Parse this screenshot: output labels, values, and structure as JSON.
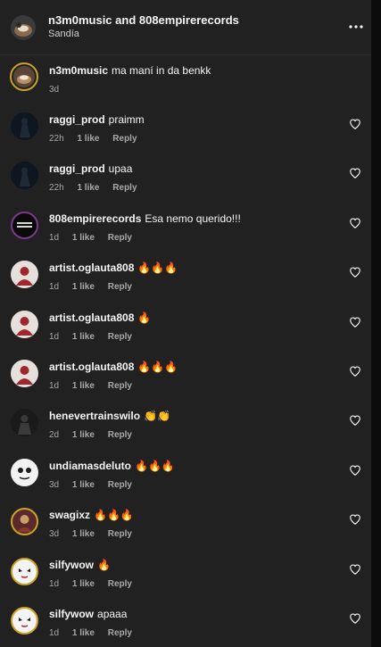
{
  "header": {
    "title": "n3m0music and 808empirerecords",
    "subtitle": "Sandía"
  },
  "caption": {
    "username": "n3m0music",
    "text": "ma maní in da benkk",
    "time": "3d"
  },
  "comments": [
    {
      "username": "raggi_prod",
      "text": "praimm",
      "time": "22h",
      "likes": "1 like",
      "reply": "Reply",
      "avatar": "dark-silhouette"
    },
    {
      "username": "raggi_prod",
      "text": "upaa",
      "time": "22h",
      "likes": "1 like",
      "reply": "Reply",
      "avatar": "dark-silhouette"
    },
    {
      "username": "808empirerecords",
      "text": "Esa nemo querido!!!",
      "time": "1d",
      "likes": "1 like",
      "reply": "Reply",
      "avatar": "record-logo"
    },
    {
      "username": "artist.oglauta808",
      "text": "🔥🔥🔥",
      "time": "1d",
      "likes": "1 like",
      "reply": "Reply",
      "avatar": "red-character"
    },
    {
      "username": "artist.oglauta808",
      "text": "🔥",
      "time": "1d",
      "likes": "1 like",
      "reply": "Reply",
      "avatar": "red-character"
    },
    {
      "username": "artist.oglauta808",
      "text": "🔥🔥🔥",
      "time": "1d",
      "likes": "1 like",
      "reply": "Reply",
      "avatar": "red-character"
    },
    {
      "username": "henevertrainswilo",
      "text": "👏👏",
      "time": "2d",
      "likes": "1 like",
      "reply": "Reply",
      "avatar": "dark-figure"
    },
    {
      "username": "undiamasdeluto",
      "text": "🔥🔥🔥",
      "time": "3d",
      "likes": "1 like",
      "reply": "Reply",
      "avatar": "white-face"
    },
    {
      "username": "swagixz",
      "text": "🔥🔥🔥",
      "time": "3d",
      "likes": "1 like",
      "reply": "Reply",
      "avatar": "story-ring"
    },
    {
      "username": "silfywow",
      "text": "🔥",
      "time": "1d",
      "likes": "1 like",
      "reply": "Reply",
      "avatar": "mask-ring"
    },
    {
      "username": "silfywow",
      "text": "apaaa",
      "time": "1d",
      "likes": "1 like",
      "reply": "Reply",
      "avatar": "mask-ring"
    }
  ],
  "colors": {
    "panel": "#212121",
    "background": "#000000",
    "text": "#f5f5f5",
    "muted": "#a8a8a8",
    "story_ring": "#c9a227"
  },
  "icons": {
    "more": "more-horizontal-icon",
    "like": "heart-outline-icon"
  }
}
